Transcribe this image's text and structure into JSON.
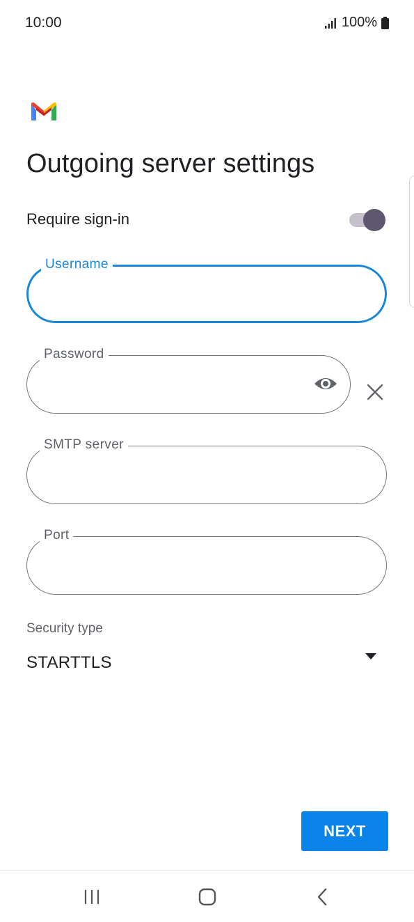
{
  "status_bar": {
    "time": "10:00",
    "battery": "100%",
    "icons": [
      "signal-icon",
      "battery-icon"
    ]
  },
  "app": {
    "logo": "gmail-logo"
  },
  "page": {
    "title": "Outgoing server settings"
  },
  "require_signin": {
    "label": "Require sign-in",
    "enabled": true
  },
  "fields": {
    "username": {
      "label": "Username",
      "value": ""
    },
    "password": {
      "label": "Password",
      "value": ""
    },
    "smtp_server": {
      "label": "SMTP server",
      "value": ""
    },
    "port": {
      "label": "Port",
      "value": ""
    }
  },
  "security": {
    "label": "Security type",
    "selected": "STARTTLS"
  },
  "actions": {
    "next_label": "NEXT"
  },
  "colors": {
    "accent": "#1a87d6",
    "button": "#0a84e8",
    "toggle_knob": "#5f5670",
    "toggle_track": "#c4c1cb"
  },
  "nav": {
    "icons": [
      "recent-apps-icon",
      "home-icon",
      "back-icon"
    ]
  }
}
